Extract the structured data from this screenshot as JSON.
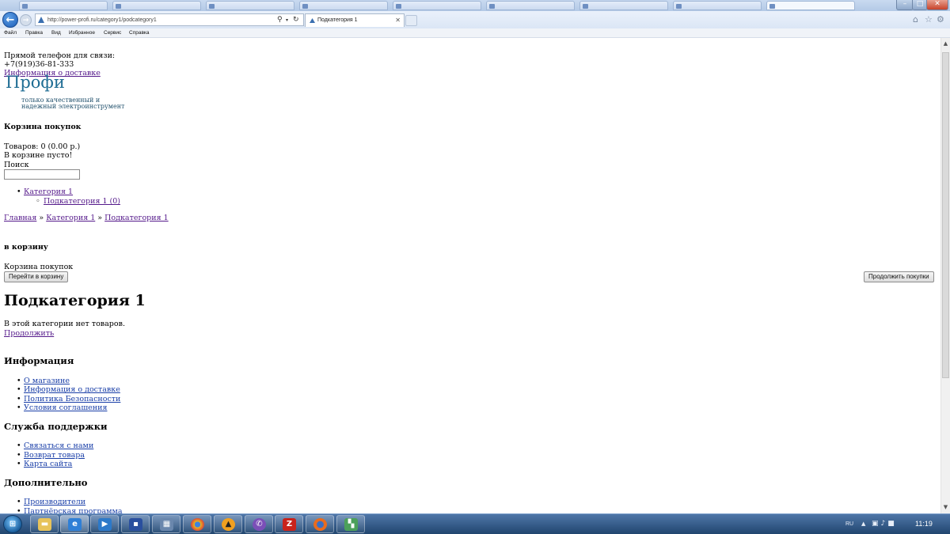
{
  "browser": {
    "url": "http://power-profi.ru/category1/podcategory1",
    "active_tab_title": "Подкатегория 1",
    "tab_close": "✕",
    "menu": [
      "Файл",
      "Правка",
      "Вид",
      "Избранное",
      "Сервис",
      "Справка"
    ]
  },
  "icons": {
    "back": "back-arrow-icon",
    "forward": "forward-arrow-icon",
    "search": "search-icon",
    "refresh": "refresh-icon",
    "home": "home-icon",
    "favorites": "star-icon",
    "tools": "gear-icon"
  },
  "header": {
    "phone_label": "Прямой телефон для связи:",
    "phone": "+7(919)36-81-333",
    "delivery_link": "Информация о доставке",
    "logo": "Профи",
    "tagline": "только качественный и надежный электроинструмент"
  },
  "cart": {
    "title": "Корзина покупок",
    "summary": "Товаров: 0 (0.00 р.)",
    "empty": "В корзине пусто!"
  },
  "search": {
    "label": "Поиск",
    "value": ""
  },
  "categories": {
    "category": "Категория 1",
    "subcategory": "Подкатегория 1 (0)"
  },
  "breadcrumb": {
    "home": "Главная",
    "sep": "»",
    "category": "Категория 1",
    "current": "Подкатегория 1"
  },
  "add_to_cart": {
    "title": "в корзину",
    "cart_label": "Корзина покупок",
    "go_to_cart": "Перейти в корзину",
    "continue_shopping": "Продолжить покупки"
  },
  "main": {
    "title": "Подкатегория 1",
    "no_products": "В этой категории нет товаров.",
    "continue_link": "Продолжить"
  },
  "footer": {
    "info_title": "Информация",
    "info_links": [
      "О магазине",
      "Информация о доставке",
      "Политика Безопасности",
      "Условия соглашения"
    ],
    "support_title": "Служба поддержки",
    "support_links": [
      "Связаться с нами",
      "Возврат товара",
      "Карта сайта"
    ],
    "extra_title": "Дополнительно",
    "extra_links": [
      "Производители",
      "Партнёрская программа"
    ]
  },
  "taskbar": {
    "language": "RU",
    "clock": "11:19"
  }
}
